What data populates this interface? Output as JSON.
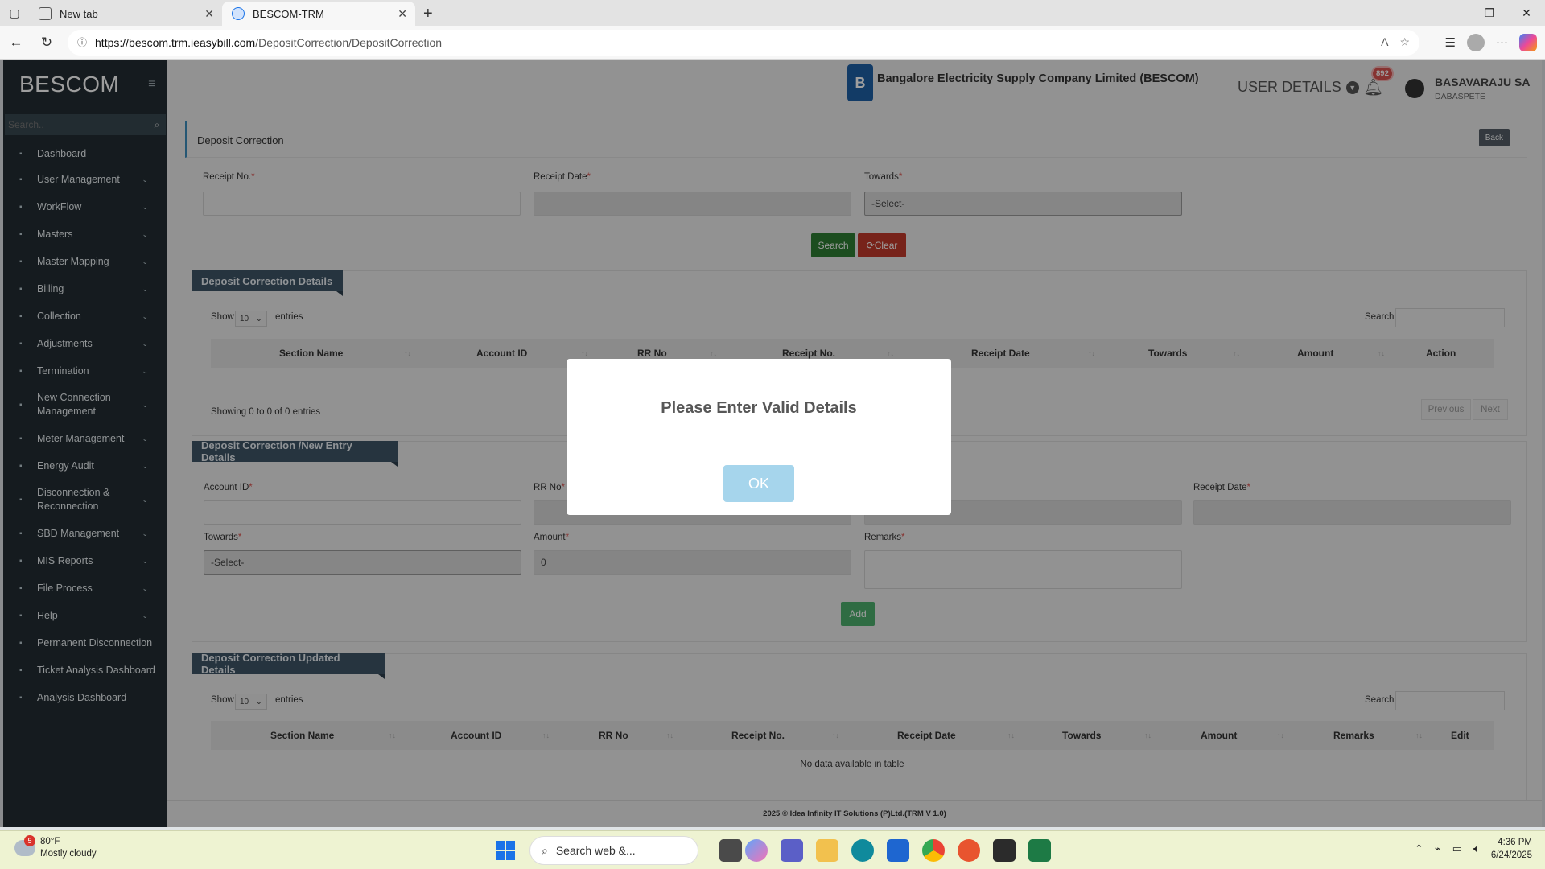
{
  "browser": {
    "tabs": [
      {
        "label": "New tab"
      },
      {
        "label": "BESCOM-TRM"
      }
    ],
    "url_host": "https://bescom.trm.ieasybill.com",
    "url_path": "/DepositCorrection/DepositCorrection"
  },
  "sidebar": {
    "brand": "BESCOM",
    "search_placeholder": "Search..",
    "items": [
      {
        "label": "Dashboard"
      },
      {
        "label": "User Management"
      },
      {
        "label": "WorkFlow"
      },
      {
        "label": "Masters"
      },
      {
        "label": "Master Mapping"
      },
      {
        "label": "Billing"
      },
      {
        "label": "Collection"
      },
      {
        "label": "Adjustments"
      },
      {
        "label": "Termination"
      },
      {
        "label": "New Connection Management"
      },
      {
        "label": "Meter Management"
      },
      {
        "label": "Energy Audit"
      },
      {
        "label": "Disconnection & Reconnection"
      },
      {
        "label": "SBD Management"
      },
      {
        "label": "MIS Reports"
      },
      {
        "label": "File Process"
      },
      {
        "label": "Help"
      },
      {
        "label": "Permanent Disconnection"
      },
      {
        "label": "Ticket Analysis Dashboard"
      },
      {
        "label": "Analysis Dashboard"
      }
    ]
  },
  "header": {
    "company": "Bangalore Electricity Supply Company Limited (BESCOM)",
    "user_details": "USER DETAILS",
    "notification_count": "892",
    "user_name": "BASAVARAJU SA",
    "user_location": "DABASPETE"
  },
  "page": {
    "title": "Deposit Correction",
    "back": "Back",
    "search_form": {
      "receipt_no_label": "Receipt No.",
      "receipt_date_label": "Receipt Date",
      "towards_label": "Towards",
      "towards_value": "-Select-",
      "search_btn": "Search",
      "clear_btn": "Clear"
    },
    "details": {
      "title": "Deposit Correction Details",
      "show": "Show",
      "entries_count": "10",
      "entries": "entries",
      "search_label": "Search:",
      "columns": [
        "Section Name",
        "Account ID",
        "RR No",
        "Receipt No.",
        "Receipt Date",
        "Towards",
        "Amount",
        "Action"
      ],
      "info": "Showing 0 to 0 of 0 entries",
      "previous": "Previous",
      "next": "Next"
    },
    "new_entry": {
      "title": "Deposit Correction /New Entry Details",
      "account_id_label": "Account ID",
      "rr_no_label": "RR No",
      "receipt_date_label": "Receipt Date",
      "towards_label": "Towards",
      "towards_value": "-Select-",
      "amount_label": "Amount",
      "amount_value": "0",
      "remarks_label": "Remarks",
      "add_btn": "Add"
    },
    "updated": {
      "title": "Deposit Correction Updated Details",
      "show": "Show",
      "entries_count": "10",
      "entries": "entries",
      "search_label": "Search:",
      "columns": [
        "Section Name",
        "Account ID",
        "RR No",
        "Receipt No.",
        "Receipt Date",
        "Towards",
        "Amount",
        "Remarks",
        "Edit"
      ],
      "empty": "No data available in table"
    },
    "footer": "2025 © Idea Infinity IT Solutions (P)Ltd.(TRM V 1.0)"
  },
  "modal": {
    "message": "Please Enter Valid Details",
    "ok": "OK"
  },
  "taskbar": {
    "weather_badge": "5",
    "temp": "80°F",
    "weather": "Mostly cloudy",
    "search": "Search web &...",
    "time": "4:36 PM",
    "date": "6/24/2025"
  }
}
